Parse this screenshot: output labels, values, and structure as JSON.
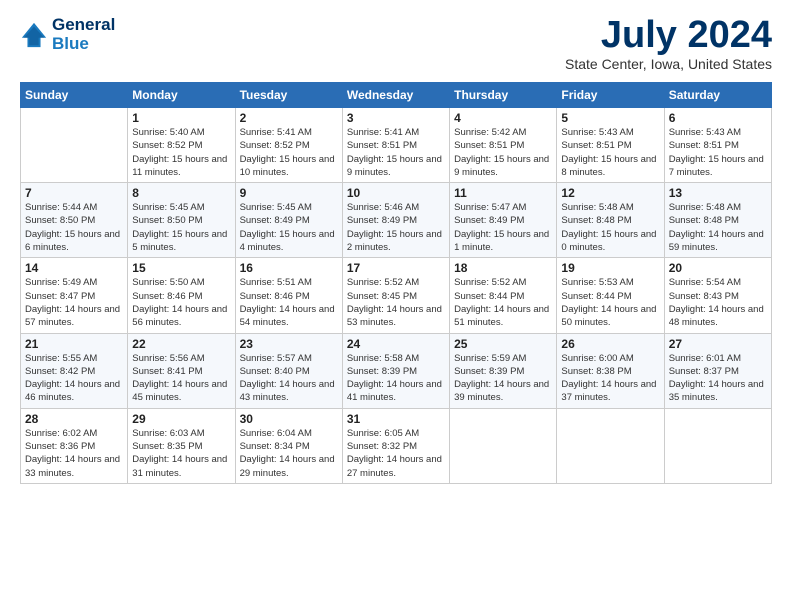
{
  "logo": {
    "line1": "General",
    "line2": "Blue"
  },
  "title": "July 2024",
  "location": "State Center, Iowa, United States",
  "days_of_week": [
    "Sunday",
    "Monday",
    "Tuesday",
    "Wednesday",
    "Thursday",
    "Friday",
    "Saturday"
  ],
  "weeks": [
    [
      {
        "day": "",
        "sunrise": "",
        "sunset": "",
        "daylight": ""
      },
      {
        "day": "1",
        "sunrise": "Sunrise: 5:40 AM",
        "sunset": "Sunset: 8:52 PM",
        "daylight": "Daylight: 15 hours and 11 minutes."
      },
      {
        "day": "2",
        "sunrise": "Sunrise: 5:41 AM",
        "sunset": "Sunset: 8:52 PM",
        "daylight": "Daylight: 15 hours and 10 minutes."
      },
      {
        "day": "3",
        "sunrise": "Sunrise: 5:41 AM",
        "sunset": "Sunset: 8:51 PM",
        "daylight": "Daylight: 15 hours and 9 minutes."
      },
      {
        "day": "4",
        "sunrise": "Sunrise: 5:42 AM",
        "sunset": "Sunset: 8:51 PM",
        "daylight": "Daylight: 15 hours and 9 minutes."
      },
      {
        "day": "5",
        "sunrise": "Sunrise: 5:43 AM",
        "sunset": "Sunset: 8:51 PM",
        "daylight": "Daylight: 15 hours and 8 minutes."
      },
      {
        "day": "6",
        "sunrise": "Sunrise: 5:43 AM",
        "sunset": "Sunset: 8:51 PM",
        "daylight": "Daylight: 15 hours and 7 minutes."
      }
    ],
    [
      {
        "day": "7",
        "sunrise": "Sunrise: 5:44 AM",
        "sunset": "Sunset: 8:50 PM",
        "daylight": "Daylight: 15 hours and 6 minutes."
      },
      {
        "day": "8",
        "sunrise": "Sunrise: 5:45 AM",
        "sunset": "Sunset: 8:50 PM",
        "daylight": "Daylight: 15 hours and 5 minutes."
      },
      {
        "day": "9",
        "sunrise": "Sunrise: 5:45 AM",
        "sunset": "Sunset: 8:49 PM",
        "daylight": "Daylight: 15 hours and 4 minutes."
      },
      {
        "day": "10",
        "sunrise": "Sunrise: 5:46 AM",
        "sunset": "Sunset: 8:49 PM",
        "daylight": "Daylight: 15 hours and 2 minutes."
      },
      {
        "day": "11",
        "sunrise": "Sunrise: 5:47 AM",
        "sunset": "Sunset: 8:49 PM",
        "daylight": "Daylight: 15 hours and 1 minute."
      },
      {
        "day": "12",
        "sunrise": "Sunrise: 5:48 AM",
        "sunset": "Sunset: 8:48 PM",
        "daylight": "Daylight: 15 hours and 0 minutes."
      },
      {
        "day": "13",
        "sunrise": "Sunrise: 5:48 AM",
        "sunset": "Sunset: 8:48 PM",
        "daylight": "Daylight: 14 hours and 59 minutes."
      }
    ],
    [
      {
        "day": "14",
        "sunrise": "Sunrise: 5:49 AM",
        "sunset": "Sunset: 8:47 PM",
        "daylight": "Daylight: 14 hours and 57 minutes."
      },
      {
        "day": "15",
        "sunrise": "Sunrise: 5:50 AM",
        "sunset": "Sunset: 8:46 PM",
        "daylight": "Daylight: 14 hours and 56 minutes."
      },
      {
        "day": "16",
        "sunrise": "Sunrise: 5:51 AM",
        "sunset": "Sunset: 8:46 PM",
        "daylight": "Daylight: 14 hours and 54 minutes."
      },
      {
        "day": "17",
        "sunrise": "Sunrise: 5:52 AM",
        "sunset": "Sunset: 8:45 PM",
        "daylight": "Daylight: 14 hours and 53 minutes."
      },
      {
        "day": "18",
        "sunrise": "Sunrise: 5:52 AM",
        "sunset": "Sunset: 8:44 PM",
        "daylight": "Daylight: 14 hours and 51 minutes."
      },
      {
        "day": "19",
        "sunrise": "Sunrise: 5:53 AM",
        "sunset": "Sunset: 8:44 PM",
        "daylight": "Daylight: 14 hours and 50 minutes."
      },
      {
        "day": "20",
        "sunrise": "Sunrise: 5:54 AM",
        "sunset": "Sunset: 8:43 PM",
        "daylight": "Daylight: 14 hours and 48 minutes."
      }
    ],
    [
      {
        "day": "21",
        "sunrise": "Sunrise: 5:55 AM",
        "sunset": "Sunset: 8:42 PM",
        "daylight": "Daylight: 14 hours and 46 minutes."
      },
      {
        "day": "22",
        "sunrise": "Sunrise: 5:56 AM",
        "sunset": "Sunset: 8:41 PM",
        "daylight": "Daylight: 14 hours and 45 minutes."
      },
      {
        "day": "23",
        "sunrise": "Sunrise: 5:57 AM",
        "sunset": "Sunset: 8:40 PM",
        "daylight": "Daylight: 14 hours and 43 minutes."
      },
      {
        "day": "24",
        "sunrise": "Sunrise: 5:58 AM",
        "sunset": "Sunset: 8:39 PM",
        "daylight": "Daylight: 14 hours and 41 minutes."
      },
      {
        "day": "25",
        "sunrise": "Sunrise: 5:59 AM",
        "sunset": "Sunset: 8:39 PM",
        "daylight": "Daylight: 14 hours and 39 minutes."
      },
      {
        "day": "26",
        "sunrise": "Sunrise: 6:00 AM",
        "sunset": "Sunset: 8:38 PM",
        "daylight": "Daylight: 14 hours and 37 minutes."
      },
      {
        "day": "27",
        "sunrise": "Sunrise: 6:01 AM",
        "sunset": "Sunset: 8:37 PM",
        "daylight": "Daylight: 14 hours and 35 minutes."
      }
    ],
    [
      {
        "day": "28",
        "sunrise": "Sunrise: 6:02 AM",
        "sunset": "Sunset: 8:36 PM",
        "daylight": "Daylight: 14 hours and 33 minutes."
      },
      {
        "day": "29",
        "sunrise": "Sunrise: 6:03 AM",
        "sunset": "Sunset: 8:35 PM",
        "daylight": "Daylight: 14 hours and 31 minutes."
      },
      {
        "day": "30",
        "sunrise": "Sunrise: 6:04 AM",
        "sunset": "Sunset: 8:34 PM",
        "daylight": "Daylight: 14 hours and 29 minutes."
      },
      {
        "day": "31",
        "sunrise": "Sunrise: 6:05 AM",
        "sunset": "Sunset: 8:32 PM",
        "daylight": "Daylight: 14 hours and 27 minutes."
      },
      {
        "day": "",
        "sunrise": "",
        "sunset": "",
        "daylight": ""
      },
      {
        "day": "",
        "sunrise": "",
        "sunset": "",
        "daylight": ""
      },
      {
        "day": "",
        "sunrise": "",
        "sunset": "",
        "daylight": ""
      }
    ]
  ]
}
